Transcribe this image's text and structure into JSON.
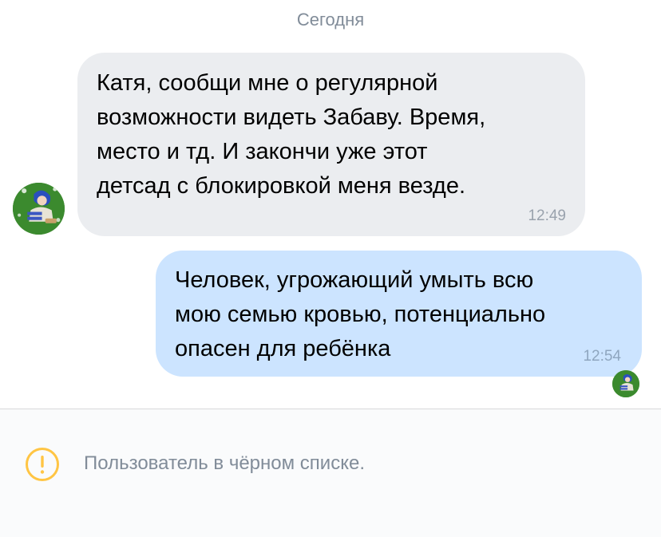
{
  "chat": {
    "date_divider": "Сегодня",
    "messages": [
      {
        "direction": "incoming",
        "text": "Катя, сообщи мне о регулярной\nвозможности видеть Забаву. Время,\nместо и тд. И закончи уже этот\nдетсад с блокировкой меня везде.",
        "time": "12:49"
      },
      {
        "direction": "outgoing",
        "text": "Человек, угрожающий умыть всю\nмою семью кровью, потенциально\nопасен для ребёнка",
        "time": "12:54"
      }
    ]
  },
  "footer": {
    "icon": "warning-circle-icon",
    "status_text": "Пользователь в чёрном списке."
  },
  "colors": {
    "incoming_bubble": "#ebedf0",
    "outgoing_bubble": "#cce4ff",
    "warning_accent": "#ffc544",
    "secondary_text": "#818c99"
  }
}
